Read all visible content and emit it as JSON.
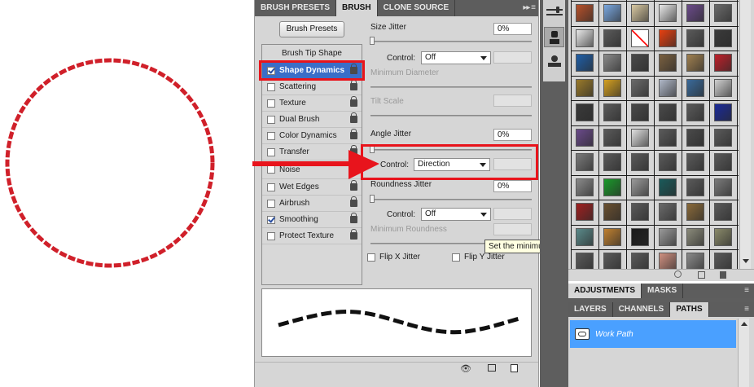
{
  "panel_tabs": {
    "brush_presets": "BRUSH PRESETS",
    "brush": "BRUSH",
    "clone_source": "CLONE SOURCE",
    "menu_glyph": "▸▸ ≡"
  },
  "brush_presets_button": "Brush Presets",
  "preset_list": {
    "header": "Brush Tip Shape",
    "items": [
      {
        "label": "Shape Dynamics",
        "checked": true,
        "selected": true
      },
      {
        "label": "Scattering",
        "checked": false,
        "selected": false
      },
      {
        "label": "Texture",
        "checked": false,
        "selected": false
      },
      {
        "label": "Dual Brush",
        "checked": false,
        "selected": false
      },
      {
        "label": "Color Dynamics",
        "checked": false,
        "selected": false
      },
      {
        "label": "Transfer",
        "checked": false,
        "selected": false
      },
      {
        "label": "Noise",
        "checked": false,
        "selected": false
      },
      {
        "label": "Wet Edges",
        "checked": false,
        "selected": false
      },
      {
        "label": "Airbrush",
        "checked": false,
        "selected": false
      },
      {
        "label": "Smoothing",
        "checked": true,
        "selected": false
      },
      {
        "label": "Protect Texture",
        "checked": false,
        "selected": false
      }
    ]
  },
  "settings": {
    "size_jitter": {
      "label": "Size Jitter",
      "value": "0%",
      "level": 0.0
    },
    "size_control": {
      "label": "Control:",
      "value": "Off"
    },
    "min_diameter": {
      "label": "Minimum Diameter"
    },
    "tilt_scale": {
      "label": "Tilt Scale"
    },
    "angle_jitter": {
      "label": "Angle Jitter",
      "value": "0%",
      "level": 0.0
    },
    "angle_control": {
      "label": "Control:",
      "value": "Direction"
    },
    "roundness_jitter": {
      "label": "Roundness Jitter",
      "value": "0%",
      "level": 0.0
    },
    "roundness_control": {
      "label": "Control:",
      "value": "Off"
    },
    "min_roundness": {
      "label": "Minimum Roundness"
    },
    "flip_x": {
      "label": "Flip X Jitter",
      "checked": false
    },
    "flip_y": {
      "label": "Flip Y Jitter",
      "checked": false
    }
  },
  "tooltip": "Set the minimum brush roundness",
  "swatch_colors": [
    [
      "#b8512a",
      "#7aa8e0",
      "#d9c9a2",
      "#e8e8e8",
      "#6b4b8a",
      "#6a6a6a"
    ],
    [
      "#e8e8e8",
      "#5a5a5a",
      "#ff0000",
      "#e84010",
      "#5a5a5a",
      "#3a3a3a"
    ],
    [
      "#1f5fa8",
      "#8a8a8a",
      "#4a4a4a",
      "#7a6040",
      "#a08050",
      "#c0202a"
    ],
    [
      "#9a7a2a",
      "#d4a020",
      "#6a6a6a",
      "#b0b8c8",
      "#3a6a9a",
      "#d0d0d0"
    ],
    [
      "#3a3a3a",
      "#5a5a5a",
      "#4a4a4a",
      "#4a4a4a",
      "#5a5a5a",
      "#1a2a9a"
    ],
    [
      "#6a4a8a",
      "#5a5a5a",
      "#e0e0e0",
      "#5a5a5a",
      "#4a4a4a",
      "#5a5a5a"
    ],
    [
      "#7a7a7a",
      "#5a5a5a",
      "#5a5a5a",
      "#5a5a5a",
      "#5a5a5a",
      "#5a5a5a"
    ],
    [
      "#8a8a8a",
      "#1a9a2a",
      "#9a9a9a",
      "#1a5a5a",
      "#5a5a5a",
      "#7a7a7a"
    ],
    [
      "#a02020",
      "#6a5030",
      "#5a5a5a",
      "#6a6a6a",
      "#8a6a3a",
      "#5a5a5a"
    ],
    [
      "#5a8a8a",
      "#c08030",
      "#1a1a1a",
      "#9a9a9a",
      "#8a8a7a",
      "#8a8a6a"
    ],
    [
      "#5a5a5a",
      "#5a5a5a",
      "#5a5a5a",
      "#d09080",
      "#8a8a8a",
      "#5a5a5a"
    ]
  ],
  "adjustments_tabs": [
    "ADJUSTMENTS",
    "MASKS"
  ],
  "layers_tabs": [
    "LAYERS",
    "CHANNELS",
    "PATHS"
  ],
  "paths": [
    {
      "label": "Work Path"
    }
  ],
  "colors": {
    "accent_red": "#e8141c",
    "selection_blue": "#3a6ec8",
    "path_blue": "#4aa0ff"
  }
}
